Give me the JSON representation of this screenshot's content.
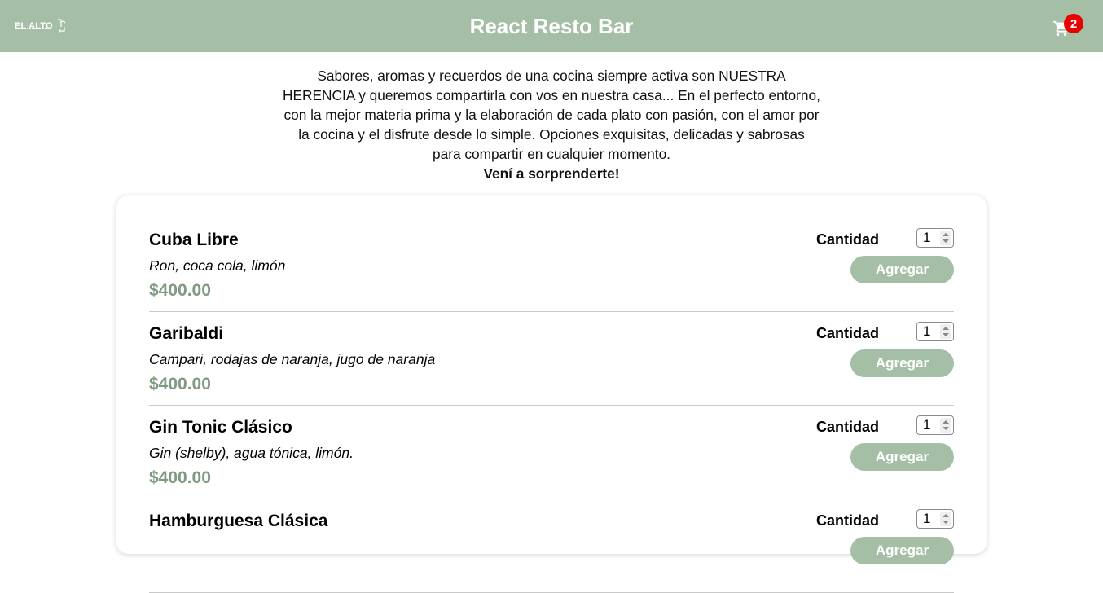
{
  "header": {
    "logo_text": "EL ALTO",
    "title": "React Resto Bar",
    "cart_count": "2",
    "cart_icon": "shopping-cart-icon"
  },
  "intro": {
    "text": "Sabores, aromas y recuerdos de una cocina siempre activa son NUESTRA HERENCIA y queremos compartirla con vos en nuestra casa... En el perfecto entorno, con la mejor materia prima y la elaboración de cada plato con pasión, con el amor por la cocina y el disfrute desde lo simple. Opciones exquisitas, delicadas y sabrosas para compartir en cualquier momento.",
    "tagline": "Vení a sorprenderte!"
  },
  "colors": {
    "header_bg": "#a5bfa6",
    "price": "#7f9a80",
    "badge": "#ea0000"
  },
  "meals": [
    {
      "name": "Cuba Libre",
      "description": "Ron, coca cola, limón",
      "price": "$400.00",
      "quantity_label": "Cantidad",
      "quantity": "1",
      "add_label": "Agregar"
    },
    {
      "name": "Garibaldi",
      "description": "Campari, rodajas de naranja, jugo de naranja",
      "price": "$400.00",
      "quantity_label": "Cantidad",
      "quantity": "1",
      "add_label": "Agregar"
    },
    {
      "name": "Gin Tonic Clásico",
      "description": "Gin (shelby), agua tónica, limón.",
      "price": "$400.00",
      "quantity_label": "Cantidad",
      "quantity": "1",
      "add_label": "Agregar"
    },
    {
      "name": "Hamburguesa Clásica",
      "description": "",
      "price": "",
      "quantity_label": "Cantidad",
      "quantity": "1",
      "add_label": "Agregar"
    }
  ]
}
